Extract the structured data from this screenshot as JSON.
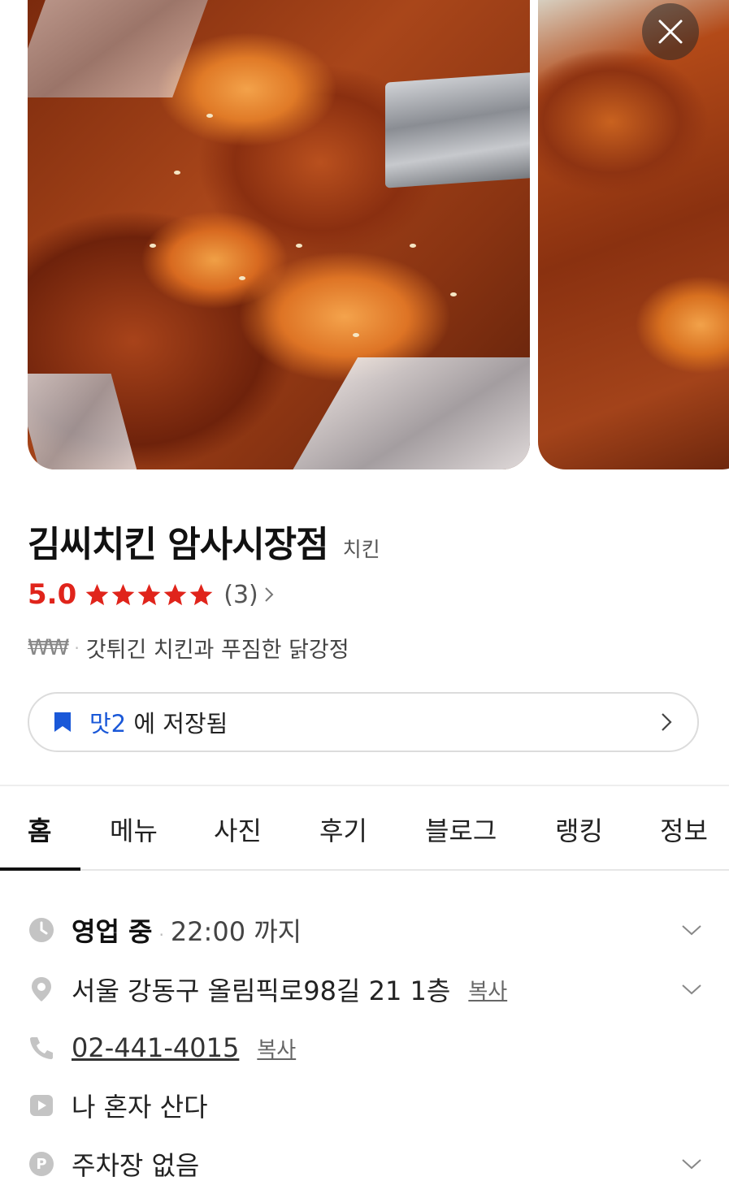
{
  "place": {
    "name": "김씨치킨 암사시장점",
    "category": "치킨",
    "rating": "5.0",
    "stars_filled": 5,
    "stars_total": 5,
    "review_count": "(3)",
    "price_level": "₩₩",
    "description": "갓튀긴 치킨과 푸짐한 닭강정"
  },
  "saved": {
    "list_name": "맛2",
    "suffix": "에 저장됨"
  },
  "tabs": [
    {
      "label": "홈",
      "active": true
    },
    {
      "label": "메뉴",
      "active": false
    },
    {
      "label": "사진",
      "active": false
    },
    {
      "label": "후기",
      "active": false
    },
    {
      "label": "블로그",
      "active": false
    },
    {
      "label": "랭킹",
      "active": false
    },
    {
      "label": "정보",
      "active": false
    }
  ],
  "info": {
    "hours_status": "영업 중",
    "hours_close": "22:00 까지",
    "address": "서울 강동구 올림픽로98길 21 1층",
    "address_copy": "복사",
    "phone": "02-441-4015",
    "phone_copy": "복사",
    "tv_program": "나 혼자 산다",
    "parking": "주차장 없음"
  },
  "icons": {
    "close": "close-icon",
    "star": "star-icon",
    "bookmark": "bookmark-icon",
    "clock": "clock-icon",
    "location": "location-pin-icon",
    "phone": "phone-icon",
    "tv": "play-icon",
    "parking": "parking-icon"
  },
  "colors": {
    "rating_red": "#e0241b",
    "link_blue": "#1a58d8",
    "icon_gray": "#c4c4c4"
  }
}
